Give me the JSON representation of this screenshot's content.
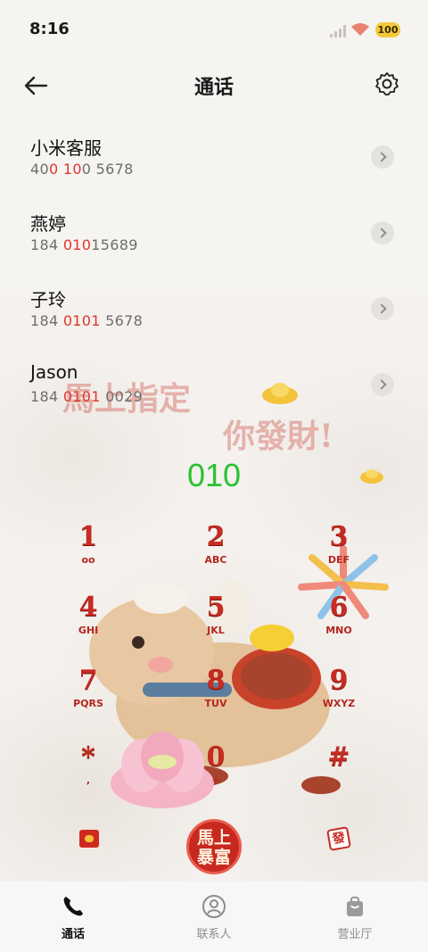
{
  "status": {
    "time": "8:16",
    "battery": "100"
  },
  "header": {
    "title": "通话"
  },
  "contacts": [
    {
      "name": "小米客服",
      "num_pre": "40",
      "num_hl": "0 10",
      "num_post": "0 5678"
    },
    {
      "name": "燕婷",
      "num_pre": "184 ",
      "num_hl": "010",
      "num_post": "15689"
    },
    {
      "name": "子玲",
      "num_pre": "184 ",
      "num_hl": "0101",
      "num_post": " 5678"
    },
    {
      "name": "Jason",
      "num_pre": "184 ",
      "num_hl": "0101",
      "num_post": " 0029"
    }
  ],
  "dial": {
    "number": "010"
  },
  "keys": [
    {
      "digit": "1",
      "letters": "ᴏᴏ"
    },
    {
      "digit": "2",
      "letters": "ABC"
    },
    {
      "digit": "3",
      "letters": "DEF"
    },
    {
      "digit": "4",
      "letters": "GHI"
    },
    {
      "digit": "5",
      "letters": "JKL"
    },
    {
      "digit": "6",
      "letters": "MNO"
    },
    {
      "digit": "7",
      "letters": "PQRS"
    },
    {
      "digit": "8",
      "letters": "TUV"
    },
    {
      "digit": "9",
      "letters": "WXYZ"
    },
    {
      "digit": "*",
      "letters": ","
    },
    {
      "digit": "0",
      "letters": "+"
    },
    {
      "digit": "#",
      "letters": ""
    }
  ],
  "callbutton": {
    "line1": "馬上",
    "line2": "暴富"
  },
  "theme_text": {
    "line1": "馬上指定",
    "line2": "你發財!"
  },
  "tabs": [
    {
      "label": "通话",
      "icon": "phone-icon"
    },
    {
      "label": "联系人",
      "icon": "person-icon"
    },
    {
      "label": "营业厅",
      "icon": "shopping-bag-icon"
    }
  ],
  "colors": {
    "accent_green": "#2bc232",
    "highlight_red": "#e0352b",
    "key_red": "#c72b22"
  }
}
